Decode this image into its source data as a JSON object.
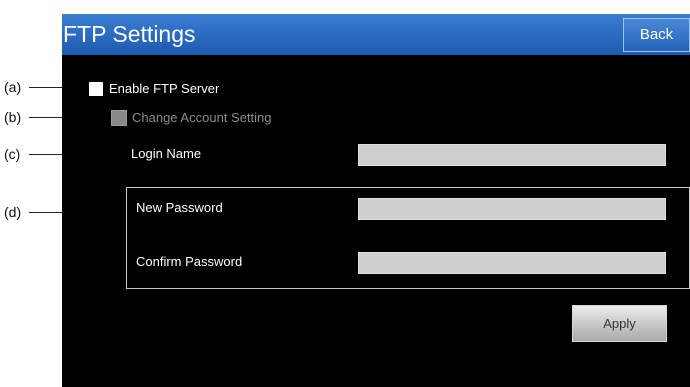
{
  "callouts": {
    "a": "(a)",
    "b": "(b)",
    "c": "(c)",
    "d": "(d)"
  },
  "header": {
    "title": "FTP Settings",
    "back_label": "Back"
  },
  "form": {
    "enable_ftp_label": "Enable FTP Server",
    "enable_ftp_checked": false,
    "change_account_label": "Change Account Setting",
    "change_account_enabled": false,
    "login_name_label": "Login Name",
    "login_name_value": "",
    "new_password_label": "New Password",
    "new_password_value": "",
    "confirm_password_label": "Confirm Password",
    "confirm_password_value": "",
    "apply_label": "Apply"
  },
  "colors": {
    "titlebar": "#2a6cc4",
    "screen_background": "#000000",
    "field_background": "#cfcfcf"
  }
}
